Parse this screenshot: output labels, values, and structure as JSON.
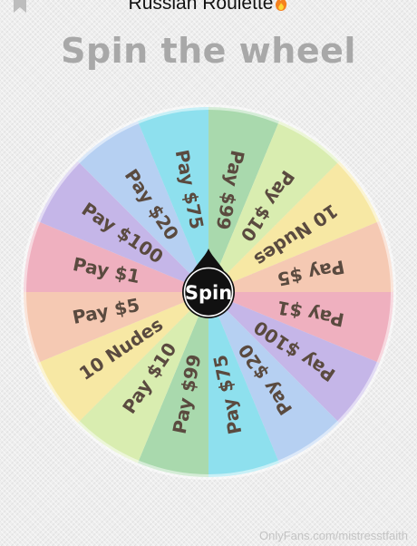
{
  "header": {
    "title": "Russian Roulette",
    "flame_icon": "fire-emoji",
    "bookmark_icon": "bookmark-icon"
  },
  "page": {
    "title": "Spin the wheel"
  },
  "wheel": {
    "spin_label": "Spin",
    "segments": [
      {
        "label": "Pay $99",
        "color": "#a9d9ad"
      },
      {
        "label": "Pay $10",
        "color": "#d9edb0"
      },
      {
        "label": "10 Nudes",
        "color": "#f7e8a4"
      },
      {
        "label": "Pay $5",
        "color": "#f5c9b3"
      },
      {
        "label": "Pay $1",
        "color": "#efb0bf"
      },
      {
        "label": "Pay $100",
        "color": "#c5b6e8"
      },
      {
        "label": "Pay $20",
        "color": "#b6d0f2"
      },
      {
        "label": "Pay $75",
        "color": "#8ee0ee"
      },
      {
        "label": "Pay $99",
        "color": "#a9d9ad"
      },
      {
        "label": "Pay $10",
        "color": "#d9edb0"
      },
      {
        "label": "10 Nudes",
        "color": "#f7e8a4"
      },
      {
        "label": "Pay $5",
        "color": "#f5c9b3"
      },
      {
        "label": "Pay $1",
        "color": "#efb0bf"
      },
      {
        "label": "Pay $100",
        "color": "#c5b6e8"
      },
      {
        "label": "Pay $20",
        "color": "#b6d0f2"
      },
      {
        "label": "Pay $75",
        "color": "#8ee0ee"
      }
    ],
    "text_color": "#5a4a3f"
  },
  "footer": {
    "watermark": "OnlyFans.com/mistresstfaith"
  }
}
